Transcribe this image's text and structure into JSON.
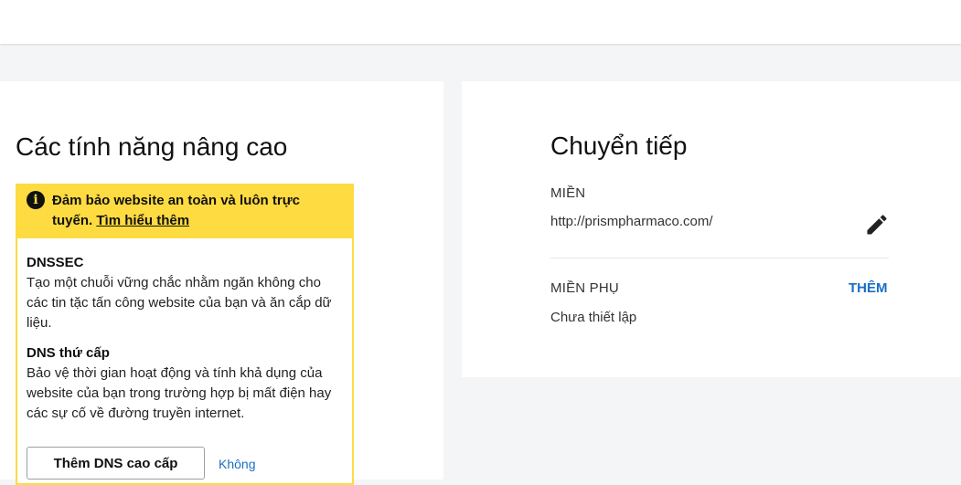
{
  "advanced": {
    "title": "Các tính năng nâng cao",
    "promo": {
      "headline": "Đảm bảo website an toàn và luôn trực tuyến.",
      "link": "Tìm hiểu thêm",
      "features": [
        {
          "title": "DNSSEC",
          "desc": "Tạo một chuỗi vững chắc nhằm ngăn không cho các tin tặc tấn công website của bạn và ăn cắp dữ liệu."
        },
        {
          "title": "DNS thứ cấp",
          "desc": "Bảo vệ thời gian hoạt động và tính khả dụng của website của bạn trong trường hợp bị mất điện hay các sự cố về đường truyền internet."
        }
      ],
      "button": "Thêm DNS cao cấp",
      "decline": "Không"
    }
  },
  "forwarding": {
    "title": "Chuyển tiếp",
    "domain_label": "MIỀN",
    "domain_value": "http://prismpharmaco.com/",
    "subdomain_label": "MIỀN PHỤ",
    "subdomain_add": "THÊM",
    "subdomain_value": "Chưa thiết lập"
  },
  "icons": {
    "info": "info-icon",
    "edit": "pencil-edit-icon"
  },
  "colors": {
    "promo_yellow": "#fedb41",
    "link_blue": "#1a6fc4"
  }
}
